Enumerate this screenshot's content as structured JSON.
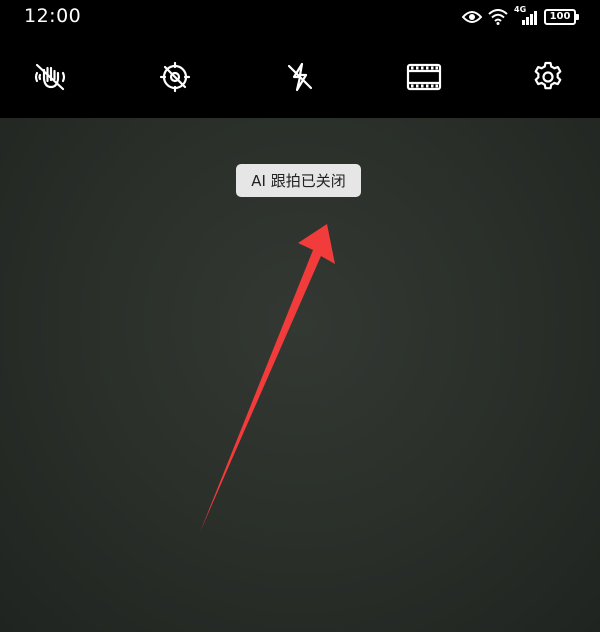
{
  "status_bar": {
    "time": "12:00",
    "icons": [
      "eye-icon",
      "wifi-icon",
      "signal-4g-icon",
      "battery-icon"
    ],
    "network_label": "4G",
    "battery_level": "100"
  },
  "toolbar": {
    "buttons": [
      {
        "icon": "stabilization-off-icon"
      },
      {
        "icon": "ai-tracking-off-icon"
      },
      {
        "icon": "flash-off-icon"
      },
      {
        "icon": "film-ratio-icon"
      },
      {
        "icon": "gear-icon"
      }
    ]
  },
  "toast": {
    "message": "AI 跟拍已关闭"
  },
  "colors": {
    "background": "#000000",
    "viewfinder": "#2a2f2a",
    "toast_bg": "#e6e6e6",
    "annotation_arrow": "#f23b3b"
  }
}
